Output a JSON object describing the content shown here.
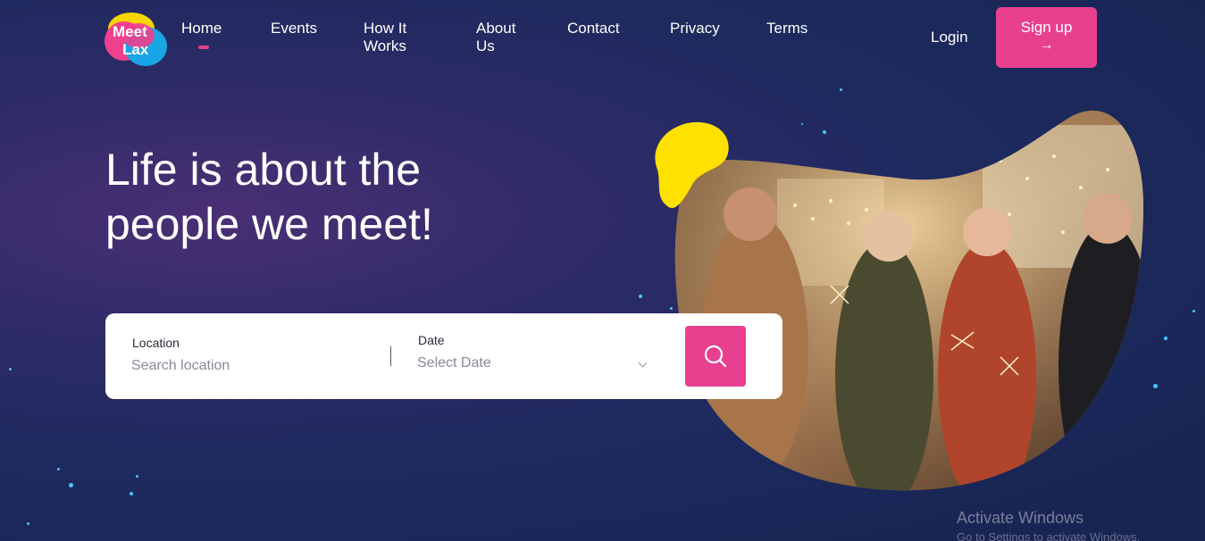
{
  "brand": {
    "logo_text_top": "Meet",
    "logo_text_bottom": "Lax",
    "accent": "#e8408f"
  },
  "nav": {
    "items": [
      {
        "label": "Home",
        "active": true
      },
      {
        "label": "Events"
      },
      {
        "label": "How It Works"
      },
      {
        "label": "About Us"
      },
      {
        "label": "Contact"
      },
      {
        "label": "Privacy"
      },
      {
        "label": "Terms"
      }
    ],
    "login_label": "Login",
    "signup_label": "Sign up",
    "signup_icon": "arrow-right-icon"
  },
  "hero": {
    "headline_line1": "Life is about the",
    "headline_line2": "people we meet!"
  },
  "search": {
    "location_label": "Location",
    "location_placeholder": "Search location",
    "date_label": "Date",
    "date_placeholder": "Select Date",
    "button_icon": "search-icon"
  },
  "watermark": {
    "title": "Activate Windows",
    "subtitle": "Go to Settings to activate Windows."
  }
}
